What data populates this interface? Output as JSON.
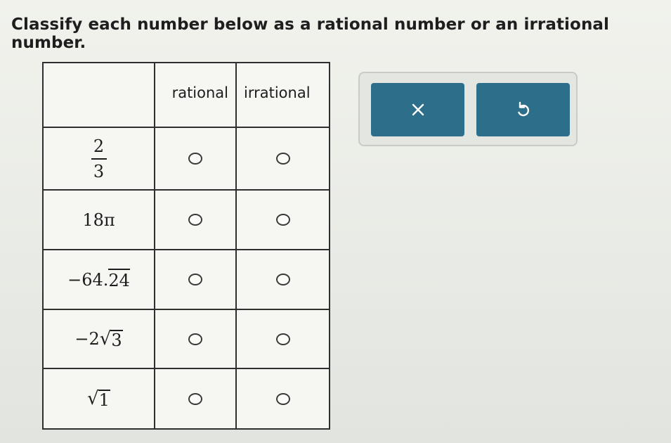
{
  "instruction": "Classify each number below as a rational number or an irrational number.",
  "table": {
    "columns": [
      "rational",
      "irrational"
    ],
    "rows": [
      {
        "number": {
          "numerator": "2",
          "denominator": "3"
        },
        "rational_selected": false,
        "irrational_selected": false
      },
      {
        "number": {
          "text": "18π"
        },
        "rational_selected": false,
        "irrational_selected": false
      },
      {
        "number": {
          "prefix": "−64.",
          "repeating": "24"
        },
        "rational_selected": false,
        "irrational_selected": false
      },
      {
        "number": {
          "prefix": "−2",
          "radicand": "3"
        },
        "rational_selected": false,
        "irrational_selected": false
      },
      {
        "number": {
          "prefix": "",
          "radicand": "1"
        },
        "rational_selected": false,
        "irrational_selected": false
      }
    ]
  },
  "actions": {
    "clear_icon": "x-icon",
    "undo_icon": "undo-icon",
    "button_color": "#2d6f8a"
  }
}
